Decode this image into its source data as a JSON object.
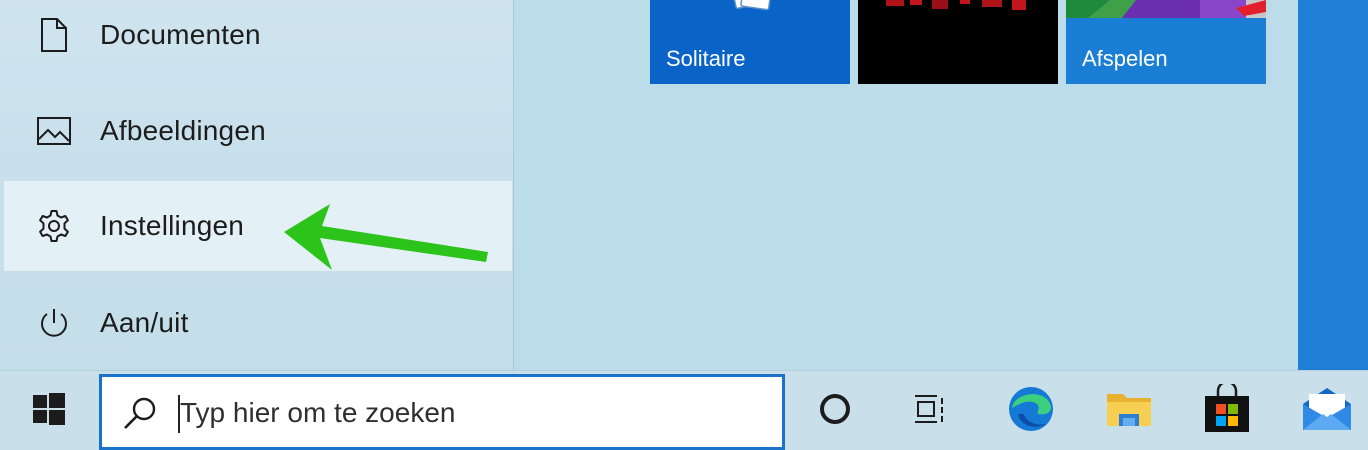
{
  "start_menu": {
    "nav_items": [
      {
        "label": "Documenten",
        "icon": "document-icon"
      },
      {
        "label": "Afbeeldingen",
        "icon": "pictures-icon"
      },
      {
        "label": "Instellingen",
        "icon": "gear-icon",
        "selected": true
      },
      {
        "label": "Aan/uit",
        "icon": "power-icon"
      }
    ],
    "tiles": [
      {
        "label": "Solitaire",
        "color": "#0a64c8"
      },
      {
        "label": "",
        "color": "#000000"
      },
      {
        "label": "Afspelen",
        "color": "#1a7ed4"
      }
    ]
  },
  "annotation": {
    "arrow_color": "#2cc41a"
  },
  "taskbar": {
    "search_placeholder": "Typ hier om te zoeken",
    "buttons": [
      "windows-start-icon",
      "cortana-icon",
      "task-view-icon",
      "edge-icon",
      "file-explorer-icon",
      "store-icon",
      "mail-icon"
    ]
  },
  "colors": {
    "accent": "#1a73c8",
    "desktop": "#1f7fd6"
  }
}
